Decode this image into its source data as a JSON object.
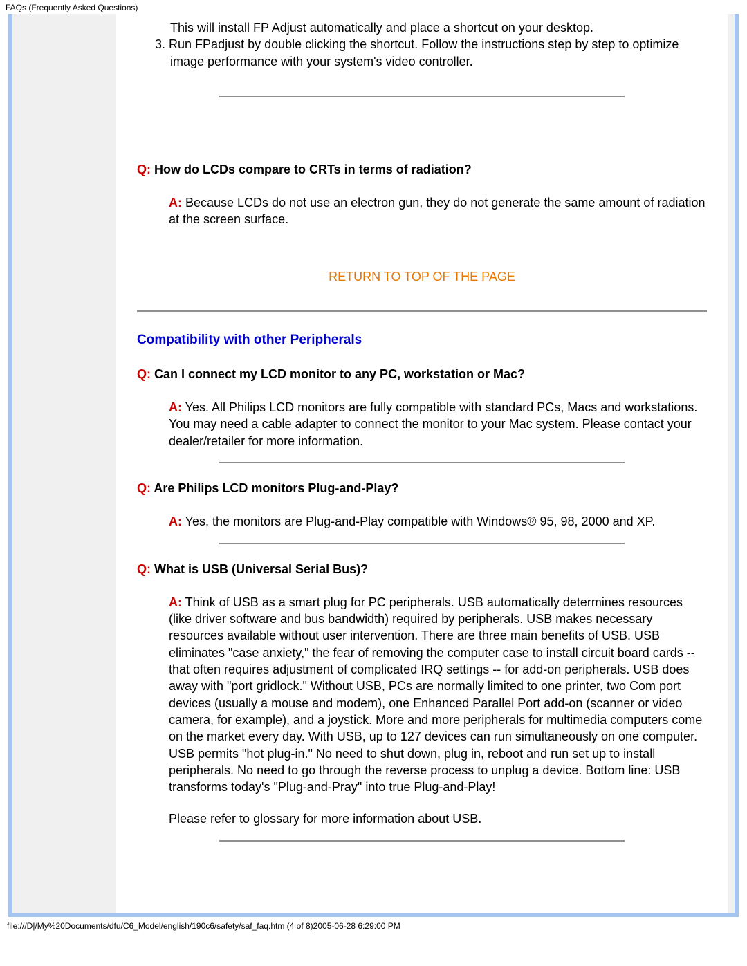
{
  "header": "FAQs (Frequently Asked Questions)",
  "intro": {
    "li1": "This will install FP Adjust automatically and place a shortcut on your desktop.",
    "li2_num": "3.",
    "li2": "Run FPadjust by double clicking the shortcut. Follow the instructions step by step to optimize image performance with your system's video controller."
  },
  "faq_radiation": {
    "q_label": "Q:",
    "q_text": " How do LCDs compare to CRTs in terms of radiation?",
    "a_label": "A:",
    "a_text": " Because LCDs do not use an electron gun, they do not generate the same amount of radiation at the screen surface."
  },
  "return_link": "RETURN TO TOP OF THE PAGE",
  "section_heading": "Compatibility with other Peripherals",
  "faq_compat": {
    "q_label": "Q:",
    "q_text": " Can I connect my LCD monitor to any PC, workstation or Mac?",
    "a_label": "A:",
    "a_text": " Yes. All Philips LCD monitors are fully compatible with standard PCs, Macs and workstations. You may need a cable adapter to connect the monitor to your Mac system. Please contact your dealer/retailer for more information."
  },
  "faq_pnp": {
    "q_label": "Q:",
    "q_text": " Are Philips LCD monitors Plug-and-Play?",
    "a_label": "A:",
    "a_text": " Yes, the monitors are Plug-and-Play compatible with Windows® 95, 98, 2000 and XP."
  },
  "faq_usb": {
    "q_label": "Q:",
    "q_text": " What is USB (Universal Serial Bus)?",
    "a_label": "A:",
    "a_text": " Think of USB as a smart plug for PC peripherals. USB automatically determines resources (like driver software and bus bandwidth) required by peripherals. USB makes necessary resources available without user intervention. There are three main benefits of USB. USB eliminates \"case anxiety,\" the fear of removing the computer case to install circuit board cards -- that often requires adjustment of complicated IRQ settings -- for add-on peripherals. USB does away with \"port gridlock.\" Without USB, PCs are normally limited to one printer, two Com port devices (usually a mouse and modem), one Enhanced Parallel Port add-on (scanner or video camera, for example), and a joystick. More and more peripherals for multimedia computers come on the market every day. With USB, up to 127 devices can run simultaneously on one computer. USB permits \"hot plug-in.\" No need to shut down, plug in, reboot and run set up to install peripherals. No need to go through the reverse process to unplug a device. Bottom line: USB transforms today's \"Plug-and-Pray\" into true Plug-and-Play!",
    "a_extra": "Please refer to glossary for more information about USB."
  },
  "footer": "file:///D|/My%20Documents/dfu/C6_Model/english/190c6/safety/saf_faq.htm (4 of 8)2005-06-28 6:29:00 PM"
}
